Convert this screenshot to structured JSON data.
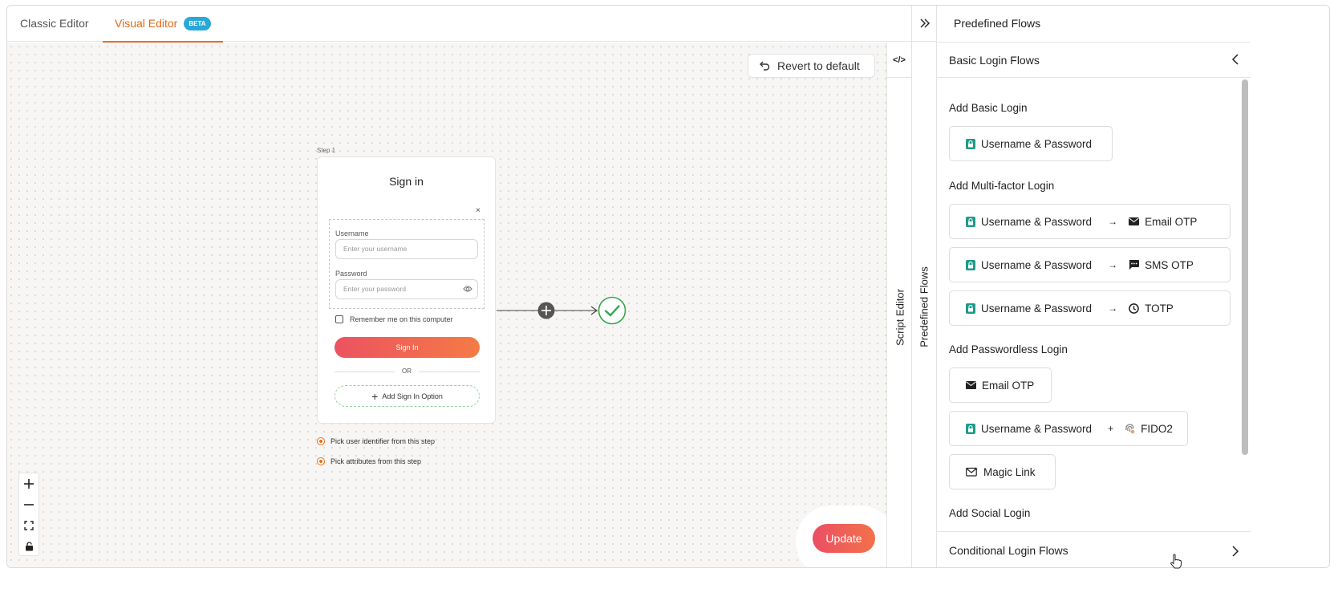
{
  "tabs": {
    "classic": "Classic Editor",
    "visual": "Visual Editor",
    "beta": "BETA"
  },
  "canvas": {
    "revert_label": "Revert to default",
    "step_label": "Step 1",
    "card": {
      "title": "Sign in",
      "close": "×",
      "username_label": "Username",
      "username_placeholder": "Enter your username",
      "password_label": "Password",
      "password_placeholder": "Enter your password",
      "remember": "Remember me on this computer",
      "signin_button": "Sign In",
      "or": "OR",
      "add_option": "Add Sign In Option"
    },
    "radio_user_identifier": "Pick user identifier from this step",
    "radio_attributes": "Pick attributes from this step",
    "update_label": "Update"
  },
  "side_strips": {
    "script_editor": "Script Editor",
    "predefined_flows": "Predefined Flows"
  },
  "right_panel": {
    "title": "Predefined Flows",
    "basic_header": "Basic Login Flows",
    "conditional_header": "Conditional Login Flows",
    "sections": {
      "basic": "Add Basic Login",
      "mfa": "Add Multi-factor Login",
      "passwordless": "Add Passwordless Login",
      "social": "Add Social Login"
    },
    "flows": {
      "basic_up": "Username & Password",
      "mfa1_a": "Username & Password",
      "mfa1_b": "Email OTP",
      "mfa2_a": "Username & Password",
      "mfa2_b": "SMS OTP",
      "mfa3_a": "Username & Password",
      "mfa3_b": "TOTP",
      "pl_email": "Email OTP",
      "pl_fido_a": "Username & Password",
      "pl_fido_b": "FIDO2",
      "pl_magic": "Magic Link"
    },
    "arrow": "→",
    "plus": "+"
  },
  "colors": {
    "accent": "#e8701b",
    "beta": "#29a8d8",
    "success": "#2fa84a",
    "lock": "#1f9a8a"
  }
}
